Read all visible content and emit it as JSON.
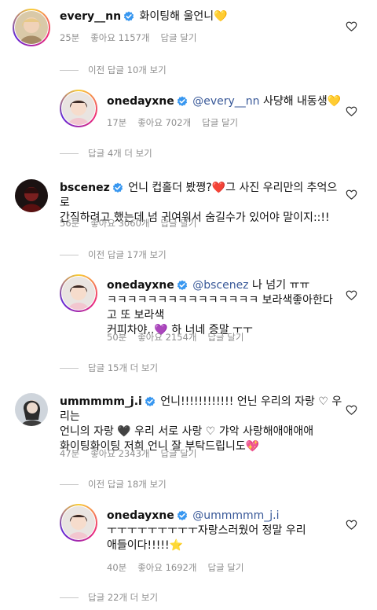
{
  "comments": [
    {
      "username": "every__nn",
      "text": "화이팅해 울언니",
      "emoji": "💛",
      "time": "25분",
      "likes": "좋아요 1157개",
      "reply": "답글 달기"
    },
    {
      "username": "onedayxne",
      "mention": "@every__nn",
      "text": " 사댱해 내동생",
      "emoji": "💛",
      "time": "17분",
      "likes": "좋아요 702개",
      "reply": "답글 달기"
    },
    {
      "username": "bscenez",
      "line1_pre": "언니 컵홀더 봤쪙?",
      "emoji": "❤️",
      "line1_post": "그 사진 우리만의 추억으로",
      "line2": "간직하려고 했는데 넘 귀여워서 숨길수가 있어야 말이지::!!",
      "time": "56분",
      "likes": "좋아요 3060개",
      "reply": "답글 달기"
    },
    {
      "username": "onedayxne",
      "mention": "@bscenez",
      "line1_post": " 나 넘기 ㅠㅠ",
      "line2": "ㅋㅋㅋㅋㅋㅋㅋㅋㅋㅋㅋㅋㅋㅋㅋ 보라색좋아한다고 또 보라색",
      "line3_pre": "커피차야..",
      "emoji": "💜",
      "line3_post": " 하 너네 증말 ㅜㅜ",
      "time": "50분",
      "likes": "좋아요 2154개",
      "reply": "답글 달기"
    },
    {
      "username": "ummmmm_j.i",
      "line1_post": "언니!!!!!!!!!!!! 언닌 우리의 자랑 ♡ 우리는",
      "line2": "언니의 자랑 🖤 우리 서로 사랑 ♡ 갸악 사랑해애애애애",
      "line3_pre": "화이팅화이팅 저희 언니 잘 부탁드립니도",
      "emoji": "💖",
      "time": "47분",
      "likes": "좋아요 2343개",
      "reply": "답글 달기"
    },
    {
      "username": "onedayxne",
      "mention": "@ummmmm_j.i",
      "line2": "ㅜㅜㅜㅜㅜㅜㅜㅜㅜ자랑스러웠어 정말 우리",
      "line3_pre": "애들이다!!!!!",
      "emoji": "⭐",
      "time": "40분",
      "likes": "좋아요 1692개",
      "reply": "답글 달기"
    }
  ],
  "threads": {
    "t1": "이전 답글 10개 보기",
    "t2": "답글 4개 더 보기",
    "t3": "이전 답글 17개 보기",
    "t4": "답글 15개 더 보기",
    "t5": "이전 답글 18개 보기",
    "t6": "답글 22개 더 보기"
  }
}
